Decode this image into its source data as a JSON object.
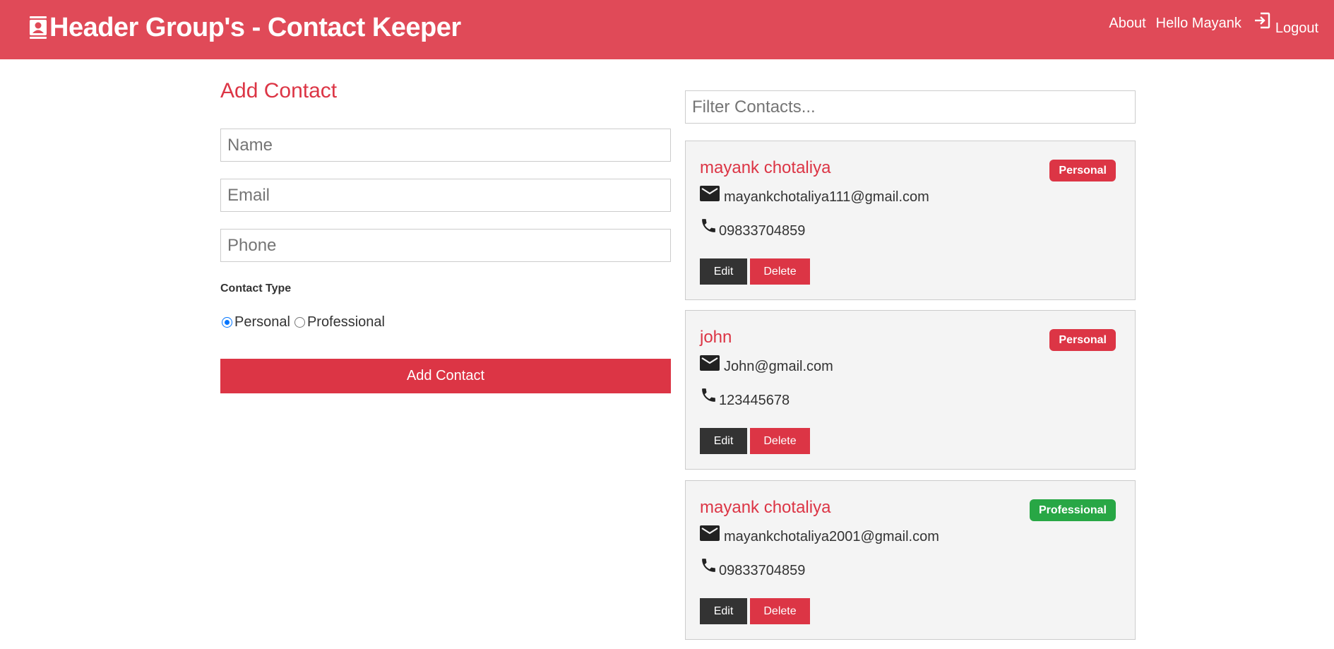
{
  "navbar": {
    "title": "Header Group's - Contact Keeper",
    "links": {
      "about": "About",
      "greeting": "Hello Mayank",
      "logout": "Logout"
    },
    "background_color": "#e04a58"
  },
  "form": {
    "title": "Add Contact",
    "name_placeholder": "Name",
    "email_placeholder": "Email",
    "phone_placeholder": "Phone",
    "type_label": "Contact Type",
    "options": {
      "personal": "Personal",
      "professional": "Professional"
    },
    "selected_type": "Personal",
    "submit_label": "Add Contact"
  },
  "filter": {
    "placeholder": "Filter Contacts..."
  },
  "contacts": [
    {
      "name": "mayank chotaliya",
      "type": "Personal",
      "email": "mayankchotaliya111@gmail.com",
      "phone": "09833704859",
      "edit_label": "Edit",
      "delete_label": "Delete"
    },
    {
      "name": "john",
      "type": "Personal",
      "email": "John@gmail.com",
      "phone": "123445678",
      "edit_label": "Edit",
      "delete_label": "Delete"
    },
    {
      "name": "mayank chotaliya",
      "type": "Professional",
      "email": "mayankchotaliya2001@gmail.com",
      "phone": "09833704859",
      "edit_label": "Edit",
      "delete_label": "Delete"
    }
  ],
  "colors": {
    "primary": "#dc3545",
    "success": "#28a745",
    "dark": "#333333",
    "card_bg": "#f4f4f4"
  },
  "icons": {
    "brand": "contact-card-icon",
    "logout": "logout-icon",
    "email": "mail-icon",
    "phone": "phone-icon"
  }
}
